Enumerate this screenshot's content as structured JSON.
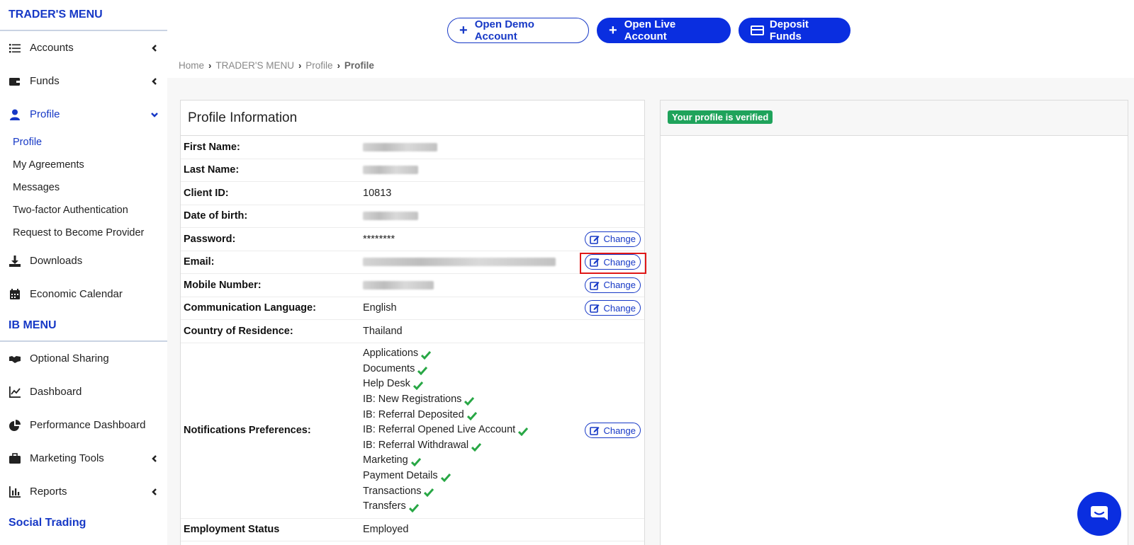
{
  "sidebar": {
    "traders_menu_title": "TRADER'S MENU",
    "ib_menu_title": "IB MENU",
    "social_trading_title": "Social Trading",
    "trader_items": [
      {
        "label": "Accounts",
        "icon": "list-icon"
      },
      {
        "label": "Funds",
        "icon": "wallet-icon"
      },
      {
        "label": "Profile",
        "icon": "user-icon"
      }
    ],
    "profile_sub": [
      "Profile",
      "My Agreements",
      "Messages",
      "Two-factor Authentication",
      "Request to Become Provider"
    ],
    "other_items": [
      {
        "label": "Downloads",
        "icon": "download-icon"
      },
      {
        "label": "Economic Calendar",
        "icon": "calendar-icon"
      }
    ],
    "ib_items": [
      {
        "label": "Optional Sharing",
        "icon": "handshake-icon"
      },
      {
        "label": "Dashboard",
        "icon": "line-chart-icon"
      },
      {
        "label": "Performance Dashboard",
        "icon": "pie-chart-icon"
      },
      {
        "label": "Marketing Tools",
        "icon": "briefcase-icon"
      },
      {
        "label": "Reports",
        "icon": "bar-chart-icon"
      }
    ]
  },
  "topbar": {
    "open_demo": "Open Demo Account",
    "open_live": "Open Live Account",
    "deposit": "Deposit Funds"
  },
  "breadcrumb": [
    "Home",
    "TRADER'S MENU",
    "Profile",
    "Profile"
  ],
  "profile": {
    "title": "Profile Information",
    "change_label": "Change",
    "fields": {
      "first_name": "First Name:",
      "last_name": "Last Name:",
      "client_id": "Client ID:",
      "client_id_value": "10813",
      "dob": "Date of birth:",
      "password": "Password:",
      "password_value": "********",
      "email": "Email:",
      "mobile": "Mobile Number:",
      "language": "Communication Language:",
      "language_value": "English",
      "country": "Country of Residence:",
      "country_value": "Thailand",
      "notifications": "Notifications Preferences:",
      "employment": "Employment Status",
      "employment_value": "Employed"
    },
    "notification_items": [
      "Applications",
      "Documents",
      "Help Desk",
      "IB: New Registrations",
      "IB: Referral Deposited",
      "IB: Referral Opened Live Account",
      "IB: Referral Withdrawal",
      "Marketing",
      "Payment Details",
      "Transactions",
      "Transfers"
    ]
  },
  "verification": {
    "badge": "Your profile is verified"
  },
  "colors": {
    "accent": "#1638c6",
    "button": "#0a2ee0",
    "verified": "#1fa35b",
    "highlight": "#e01818",
    "check": "#28a745"
  }
}
